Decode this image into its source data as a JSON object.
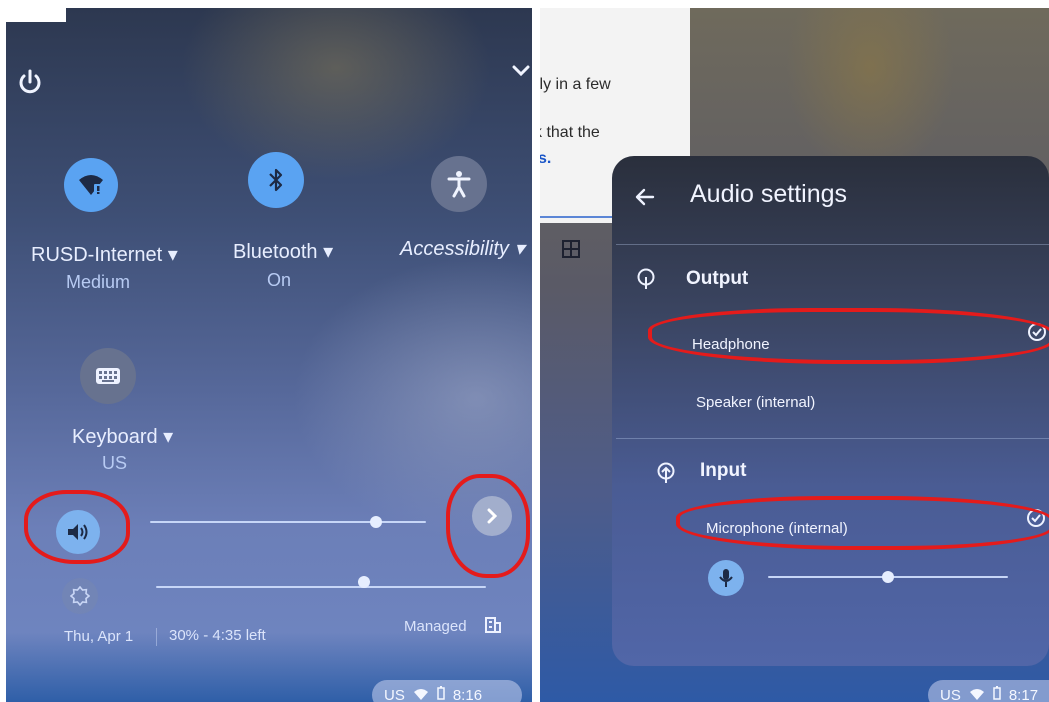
{
  "left": {
    "network": {
      "label": "RUSD-Internet",
      "status": "Medium"
    },
    "bluetooth": {
      "label": "Bluetooth",
      "status": "On"
    },
    "accessibility": {
      "label": "Accessibility"
    },
    "keyboard": {
      "label": "Keyboard",
      "status": "US"
    },
    "volume_level": 0.82,
    "brightness_level": 0.63,
    "footer": {
      "date": "Thu, Apr 1",
      "battery": "30% - 4:35 left",
      "managed": "Managed"
    },
    "tray": {
      "locale": "US",
      "time": "8:16"
    }
  },
  "right": {
    "doc_lines": [
      "lly in a few",
      "k that the",
      "s."
    ],
    "title": "Audio settings",
    "output": {
      "header": "Output",
      "items": [
        "Headphone",
        "Speaker (internal)"
      ],
      "selected": "Headphone"
    },
    "input": {
      "header": "Input",
      "items": [
        "Microphone (internal)"
      ],
      "selected": "Microphone (internal)"
    },
    "mic_level": 0.5,
    "tray": {
      "locale": "US",
      "time": "8:17"
    }
  },
  "colors": {
    "accent": "#4f9cf0",
    "annotation": "#e41b1b"
  }
}
